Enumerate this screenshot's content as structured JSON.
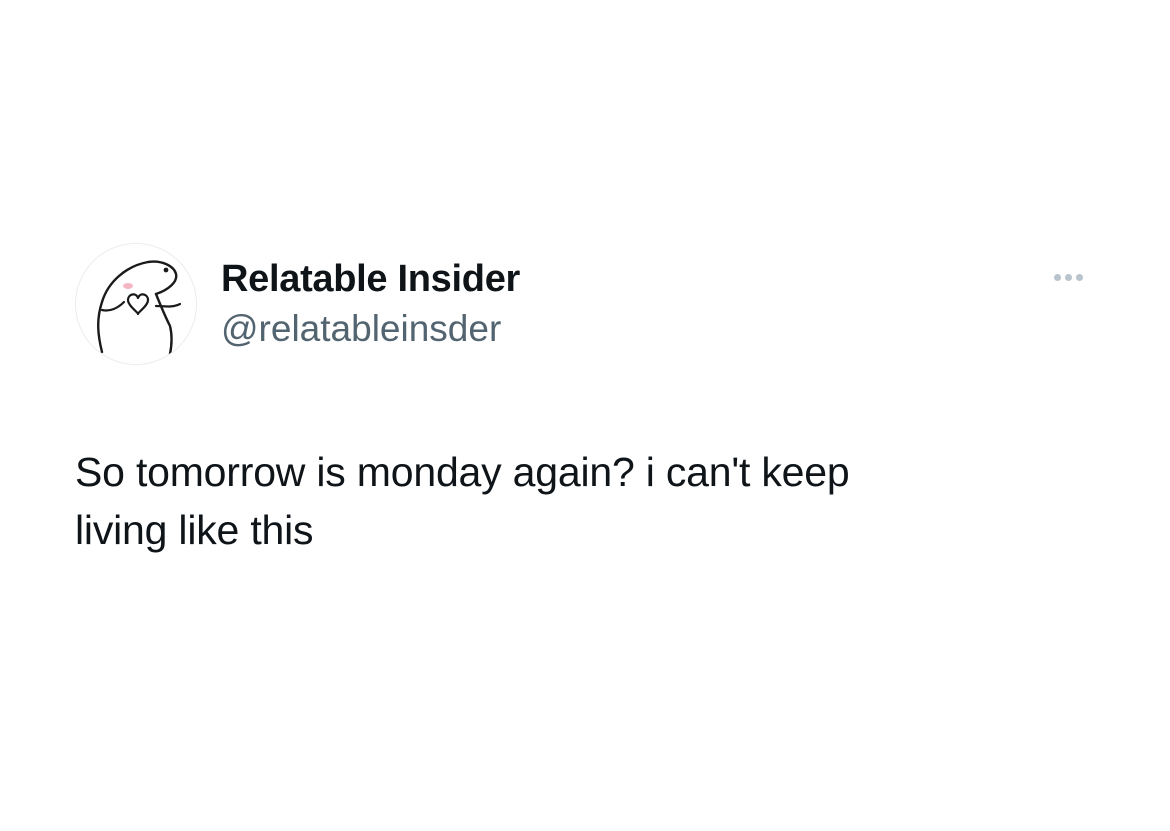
{
  "author": {
    "display_name": "Relatable Insider",
    "handle": "@relatableinsder",
    "avatar_icon": "blob-meme-avatar-icon"
  },
  "menu": {
    "icon": "more-options-icon"
  },
  "tweet": {
    "line1": "So tomorrow is monday again? i can't keep",
    "line2": "living like this"
  },
  "colors": {
    "text": "#0f1419",
    "muted": "#536471",
    "dots": "#b9c3cb",
    "blush": "#f3b6c3",
    "background": "#ffffff"
  }
}
